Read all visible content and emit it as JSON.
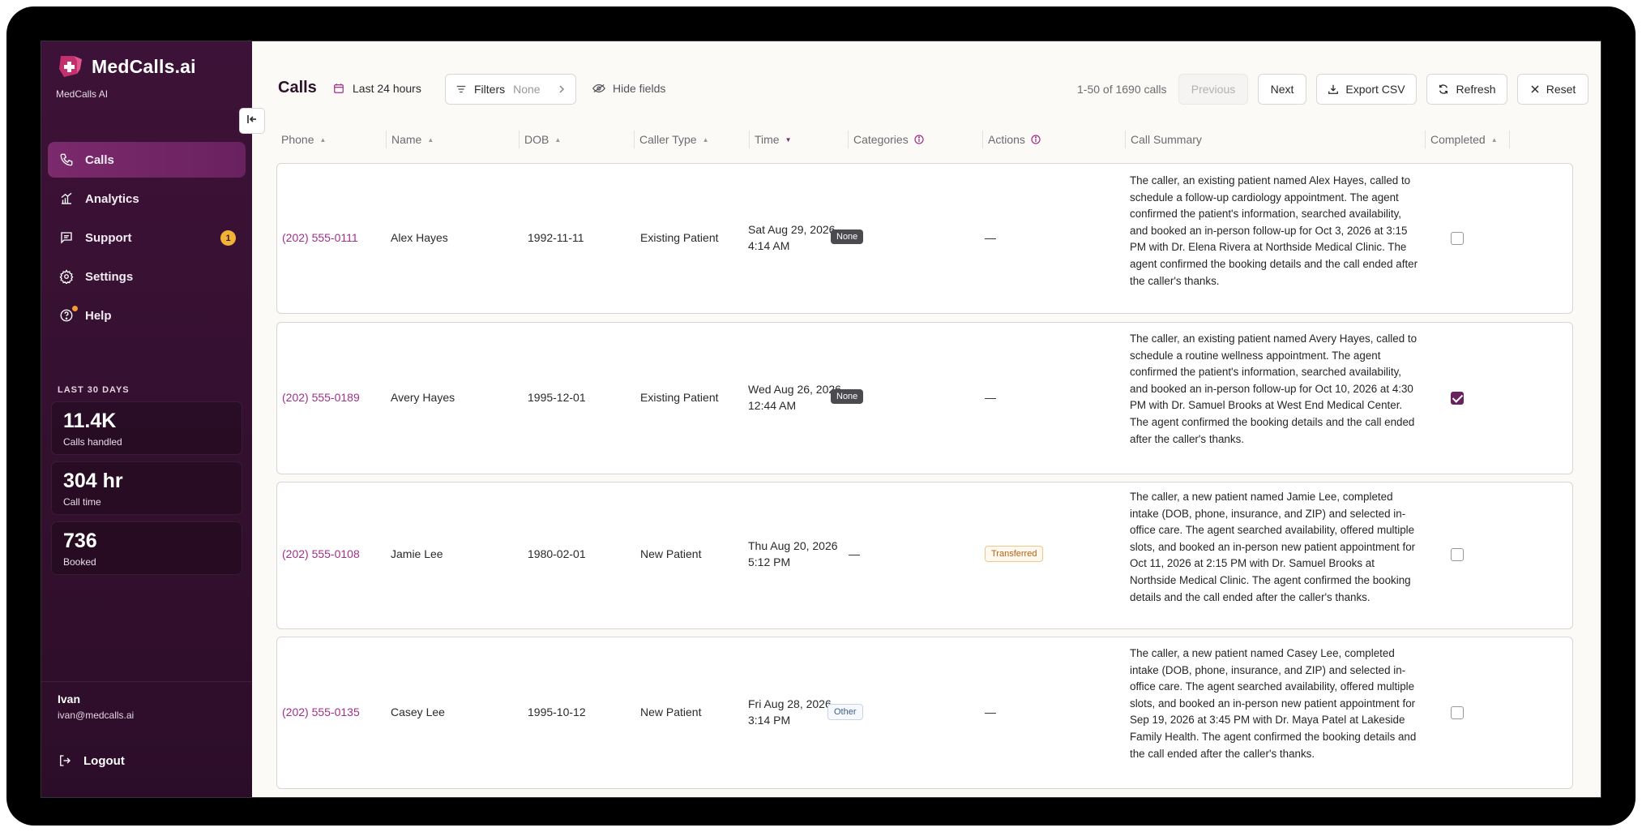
{
  "brand": {
    "title": "MedCalls.ai",
    "subtitle": "MedCalls AI"
  },
  "nav": {
    "items": [
      {
        "label": "Calls",
        "icon": "phone-icon",
        "active": true
      },
      {
        "label": "Analytics",
        "icon": "chart-icon"
      },
      {
        "label": "Support",
        "icon": "message-icon",
        "badge": "1"
      },
      {
        "label": "Settings",
        "icon": "gear-icon"
      },
      {
        "label": "Help",
        "icon": "help-icon"
      }
    ]
  },
  "stats": {
    "label": "LAST 30 DAYS",
    "cards": [
      {
        "value": "11.4K",
        "label": "Calls handled"
      },
      {
        "value": "304 hr",
        "label": "Call time"
      },
      {
        "value": "736",
        "label": "Booked"
      }
    ]
  },
  "user": {
    "name": "Ivan",
    "email": "ivan@medcalls.ai"
  },
  "logout_label": "Logout",
  "toolbar": {
    "title": "Calls",
    "range": "Last 24 hours",
    "filters_label": "Filters",
    "filters_value": "None",
    "hide_fields": "Hide fields",
    "count": "1-50 of 1690 calls",
    "previous": "Previous",
    "next": "Next",
    "export": "Export CSV",
    "refresh": "Refresh",
    "reset": "Reset"
  },
  "columns": [
    "Phone",
    "Name",
    "DOB",
    "Caller Type",
    "Time",
    "Categories",
    "Actions",
    "Call Summary",
    "Completed"
  ],
  "rows": [
    {
      "phone": "(202) 555-0111",
      "name": "Alex Hayes",
      "dob": "1992-11-11",
      "caller_type": "Existing Patient",
      "time_line1": "Sat Aug 29, 2026",
      "time_line2": "4:14 AM",
      "category": "None",
      "action": "—",
      "summary": "The caller, an existing patient named Alex Hayes, called to schedule a follow-up cardiology appointment. The agent confirmed the patient's information, searched availability, and booked an in-person follow-up for Oct 3, 2026 at 3:15 PM with Dr. Elena Rivera at Northside Medical Clinic. The agent confirmed the booking details and the call ended after the caller's thanks.",
      "completed": false
    },
    {
      "phone": "(202) 555-0189",
      "name": "Avery Hayes",
      "dob": "1995-12-01",
      "caller_type": "Existing Patient",
      "time_line1": "Wed Aug 26, 2026",
      "time_line2": "12:44 AM",
      "category": "None",
      "action": "—",
      "summary": "The caller, an existing patient named Avery Hayes, called to schedule a routine wellness appointment. The agent confirmed the patient's information, searched availability, and booked an in-person follow-up for Oct 10, 2026 at 4:30 PM with Dr. Samuel Brooks at West End Medical Center. The agent confirmed the booking details and the call ended after the caller's thanks.",
      "completed": true
    },
    {
      "phone": "(202) 555-0108",
      "name": "Jamie Lee",
      "dob": "1980-02-01",
      "caller_type": "New Patient",
      "time_line1": "Thu Aug 20, 2026",
      "time_line2": "5:12 PM",
      "category": "—",
      "action": "Transferred",
      "summary": "The caller, a new patient named Jamie Lee, completed intake (DOB, phone, insurance, and ZIP) and selected in-office care. The agent searched availability, offered multiple slots, and booked an in-person new patient appointment for Oct 11, 2026 at 2:15 PM with Dr. Samuel Brooks at Northside Medical Clinic. The agent confirmed the booking details and the call ended after the caller's thanks.",
      "completed": false
    },
    {
      "phone": "(202) 555-0135",
      "name": "Casey Lee",
      "dob": "1995-10-12",
      "caller_type": "New Patient",
      "time_line1": "Fri Aug 28, 2026",
      "time_line2": "3:14 PM",
      "category": "Other",
      "action": "—",
      "summary": "The caller, a new patient named Casey Lee, completed intake (DOB, phone, insurance, and ZIP) and selected in-office care. The agent searched availability, offered multiple slots, and booked an in-person new patient appointment for Sep 19, 2026 at 3:45 PM with Dr. Maya Patel at Lakeside Family Health. The agent confirmed the booking details and the call ended after the caller's thanks.",
      "completed": false
    }
  ],
  "colors": {
    "brand": "#3d1238",
    "accent": "#7b2a6c",
    "phone_link": "#a02f8a",
    "badge": "#f2b233"
  }
}
